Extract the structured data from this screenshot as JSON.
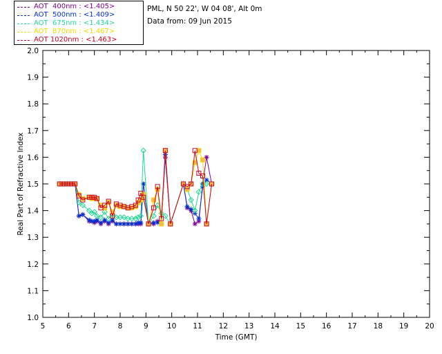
{
  "info": {
    "site_line": "PML, N 50 22', W 04 08', Alt 0m",
    "date_line": "Data from: 09 Jun 2015"
  },
  "chart_data": {
    "type": "line",
    "title": "",
    "xlabel": "Time (GMT)",
    "ylabel": "Real Part of Refractive Index",
    "xlim": [
      5,
      20
    ],
    "ylim": [
      1.0,
      2.0
    ],
    "xticks": [
      "5",
      "6",
      "7",
      "8",
      "9",
      "10",
      "11",
      "12",
      "13",
      "14",
      "15",
      "16",
      "17",
      "18",
      "19",
      "20"
    ],
    "yticks": [
      "1.0",
      "1.1",
      "1.2",
      "1.3",
      "1.4",
      "1.5",
      "1.6",
      "1.7",
      "1.8",
      "1.9",
      "2.0"
    ],
    "grid": false,
    "legend_position": "top-left",
    "series": [
      {
        "name": "AOT  400nm : <1.405>",
        "color": "#7b0090",
        "marker": "star",
        "x": [
          5.65,
          5.75,
          5.85,
          5.95,
          6.05,
          6.15,
          6.25,
          6.4,
          6.55,
          6.8,
          6.9,
          7.0,
          7.1,
          7.25,
          7.4,
          7.55,
          7.7,
          7.85,
          8.0,
          8.15,
          8.3,
          8.45,
          8.6,
          8.7,
          8.8,
          8.9,
          9.1,
          9.3,
          9.45,
          9.6,
          9.75,
          9.95,
          10.45,
          10.6,
          10.75,
          10.9,
          11.05,
          11.2,
          11.35,
          11.55
        ],
        "y": [
          1.5,
          1.5,
          1.5,
          1.5,
          1.5,
          1.5,
          1.5,
          1.38,
          1.385,
          1.36,
          1.36,
          1.355,
          1.36,
          1.35,
          1.36,
          1.35,
          1.36,
          1.35,
          1.35,
          1.35,
          1.35,
          1.35,
          1.35,
          1.35,
          1.35,
          1.5,
          1.35,
          1.35,
          1.36,
          1.35,
          1.6,
          1.35,
          1.5,
          1.41,
          1.4,
          1.35,
          1.36,
          1.5,
          1.6,
          1.5
        ]
      },
      {
        "name": "AOT  500nm : <1.409>",
        "color": "#0030d0",
        "marker": "star",
        "x": [
          5.65,
          5.75,
          5.85,
          5.95,
          6.05,
          6.15,
          6.25,
          6.4,
          6.55,
          6.8,
          6.9,
          7.0,
          7.1,
          7.25,
          7.4,
          7.55,
          7.7,
          7.85,
          8.0,
          8.15,
          8.3,
          8.45,
          8.6,
          8.7,
          8.8,
          8.9,
          9.1,
          9.3,
          9.45,
          9.6,
          9.75,
          9.95,
          10.45,
          10.6,
          10.75,
          10.9,
          11.05,
          11.2,
          11.35,
          11.55
        ],
        "y": [
          1.5,
          1.5,
          1.5,
          1.5,
          1.5,
          1.5,
          1.5,
          1.38,
          1.385,
          1.365,
          1.36,
          1.36,
          1.365,
          1.355,
          1.365,
          1.355,
          1.365,
          1.35,
          1.35,
          1.35,
          1.35,
          1.35,
          1.35,
          1.355,
          1.355,
          1.5,
          1.35,
          1.355,
          1.355,
          1.35,
          1.61,
          1.35,
          1.5,
          1.415,
          1.405,
          1.39,
          1.37,
          1.49,
          1.515,
          1.5
        ]
      },
      {
        "name": "AOT  675nm : <1.434>",
        "color": "#20d890",
        "marker": "diamond",
        "x": [
          5.65,
          5.75,
          5.85,
          5.95,
          6.05,
          6.15,
          6.25,
          6.4,
          6.55,
          6.8,
          6.9,
          7.0,
          7.1,
          7.25,
          7.4,
          7.55,
          7.7,
          7.85,
          8.0,
          8.15,
          8.3,
          8.45,
          8.6,
          8.7,
          8.8,
          8.9,
          9.1,
          9.3,
          9.45,
          9.6,
          9.75,
          9.95,
          10.45,
          10.6,
          10.75,
          10.9,
          11.05,
          11.2,
          11.35,
          11.55
        ],
        "y": [
          1.5,
          1.5,
          1.5,
          1.5,
          1.5,
          1.5,
          1.5,
          1.43,
          1.42,
          1.4,
          1.39,
          1.395,
          1.38,
          1.375,
          1.395,
          1.37,
          1.385,
          1.375,
          1.375,
          1.375,
          1.37,
          1.37,
          1.37,
          1.375,
          1.38,
          1.625,
          1.35,
          1.38,
          1.42,
          1.39,
          1.38,
          1.35,
          1.5,
          1.48,
          1.44,
          1.4,
          1.47,
          1.5,
          1.5,
          1.5
        ]
      },
      {
        "name": "AOT  870nm : <1.467>",
        "color": "#f0d800",
        "marker": "square",
        "x": [
          5.65,
          5.75,
          5.85,
          5.95,
          6.05,
          6.15,
          6.25,
          6.4,
          6.55,
          6.8,
          6.9,
          7.0,
          7.1,
          7.25,
          7.4,
          7.55,
          7.7,
          7.85,
          8.0,
          8.15,
          8.3,
          8.45,
          8.6,
          8.7,
          8.8,
          8.9,
          9.1,
          9.3,
          9.45,
          9.6,
          9.75,
          9.95,
          10.45,
          10.6,
          10.75,
          10.9,
          11.05,
          11.2,
          11.35,
          11.55
        ],
        "y": [
          1.5,
          1.5,
          1.5,
          1.5,
          1.5,
          1.5,
          1.5,
          1.46,
          1.445,
          1.45,
          1.445,
          1.445,
          1.445,
          1.42,
          1.41,
          1.43,
          1.395,
          1.42,
          1.415,
          1.415,
          1.41,
          1.41,
          1.415,
          1.43,
          1.44,
          1.46,
          1.35,
          1.44,
          1.48,
          1.35,
          1.625,
          1.35,
          1.5,
          1.48,
          1.5,
          1.58,
          1.625,
          1.59,
          1.35,
          1.5
        ]
      },
      {
        "name": "AOT 1020nm : <1.463>",
        "color": "#c80020",
        "marker": "square",
        "x": [
          5.65,
          5.75,
          5.85,
          5.95,
          6.05,
          6.15,
          6.25,
          6.4,
          6.55,
          6.8,
          6.9,
          7.0,
          7.1,
          7.25,
          7.4,
          7.55,
          7.7,
          7.85,
          8.0,
          8.15,
          8.3,
          8.45,
          8.6,
          8.7,
          8.8,
          8.9,
          9.1,
          9.3,
          9.45,
          9.6,
          9.75,
          9.95,
          10.45,
          10.6,
          10.75,
          10.9,
          11.05,
          11.2,
          11.35,
          11.55
        ],
        "y": [
          1.5,
          1.5,
          1.5,
          1.5,
          1.5,
          1.5,
          1.5,
          1.455,
          1.44,
          1.45,
          1.45,
          1.45,
          1.445,
          1.41,
          1.42,
          1.435,
          1.38,
          1.425,
          1.42,
          1.415,
          1.41,
          1.415,
          1.42,
          1.44,
          1.465,
          1.45,
          1.35,
          1.41,
          1.49,
          1.37,
          1.625,
          1.35,
          1.5,
          1.49,
          1.5,
          1.625,
          1.54,
          1.53,
          1.35,
          1.5
        ]
      }
    ]
  }
}
